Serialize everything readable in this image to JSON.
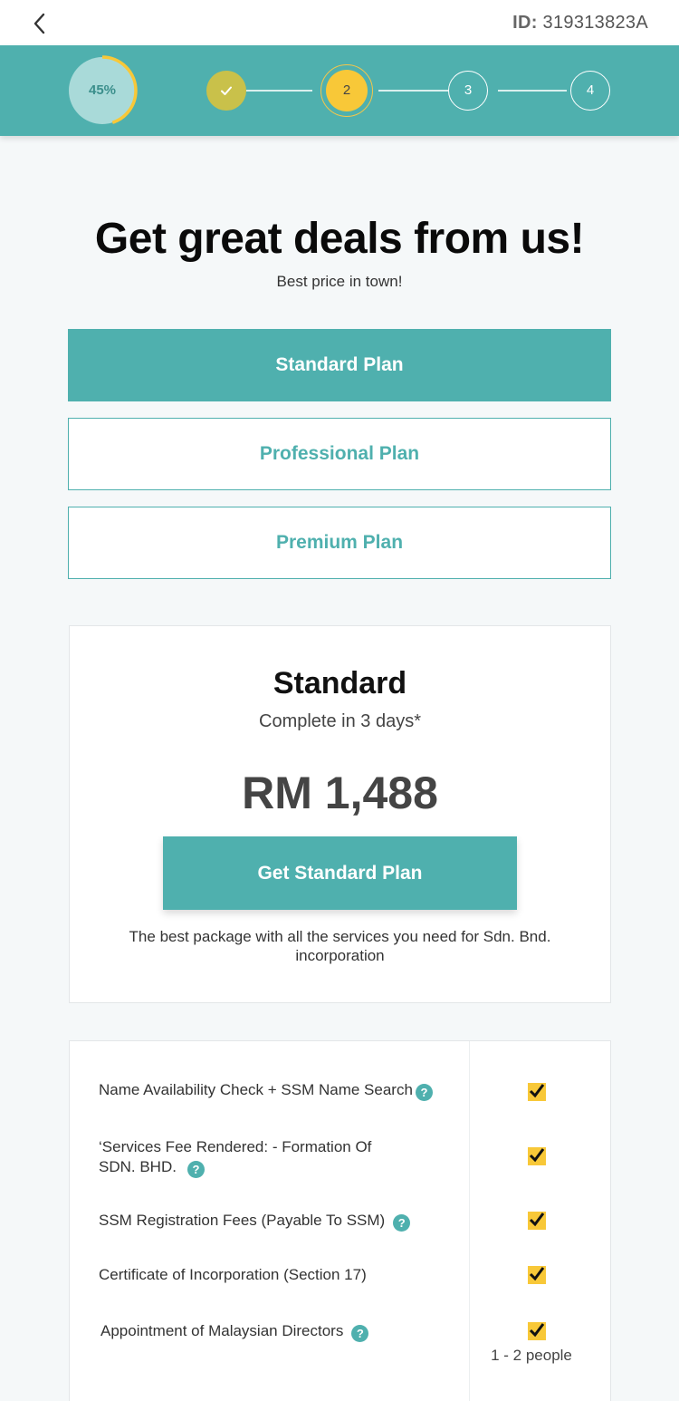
{
  "header": {
    "back_icon": "chevron-left-icon",
    "id_label": "ID:",
    "id_value": "319313823A"
  },
  "progress": {
    "percent_text": "45%",
    "percent_value": 45,
    "steps": [
      {
        "label": "✓",
        "state": "done"
      },
      {
        "label": "2",
        "state": "active"
      },
      {
        "label": "3",
        "state": "todo"
      },
      {
        "label": "4",
        "state": "todo"
      }
    ],
    "colors": {
      "band": "#4fb0ae",
      "accent": "#f8c838",
      "done": "#c9c14a"
    }
  },
  "hero": {
    "title": "Get great deals from us!",
    "subtitle": "Best price in town!"
  },
  "plans": {
    "tabs": [
      {
        "label": "Standard Plan",
        "selected": true
      },
      {
        "label": "Professional Plan",
        "selected": false
      },
      {
        "label": "Premium Plan",
        "selected": false
      }
    ]
  },
  "selected_plan": {
    "name": "Standard",
    "duration": "Complete in 3 days*",
    "price": "RM 1,488",
    "cta": "Get Standard Plan",
    "description": "The best package with all the services you need for Sdn. Bnd. incorporation"
  },
  "features": [
    {
      "label": "Name Availability Check + SSM Name Search",
      "help": true,
      "included": true,
      "note": ""
    },
    {
      "label": "‘Services Fee Rendered: - Formation Of SDN. BHD.",
      "help": true,
      "included": true,
      "note": ""
    },
    {
      "label": "SSM Registration Fees (Payable To SSM)",
      "help": true,
      "included": true,
      "note": ""
    },
    {
      "label": "Certificate of Incorporation (Section 17)",
      "help": false,
      "included": true,
      "note": ""
    },
    {
      "label": "Appointment of Malaysian Directors",
      "help": true,
      "included": true,
      "note": "1 - 2 people"
    }
  ],
  "help_glyph": "?"
}
